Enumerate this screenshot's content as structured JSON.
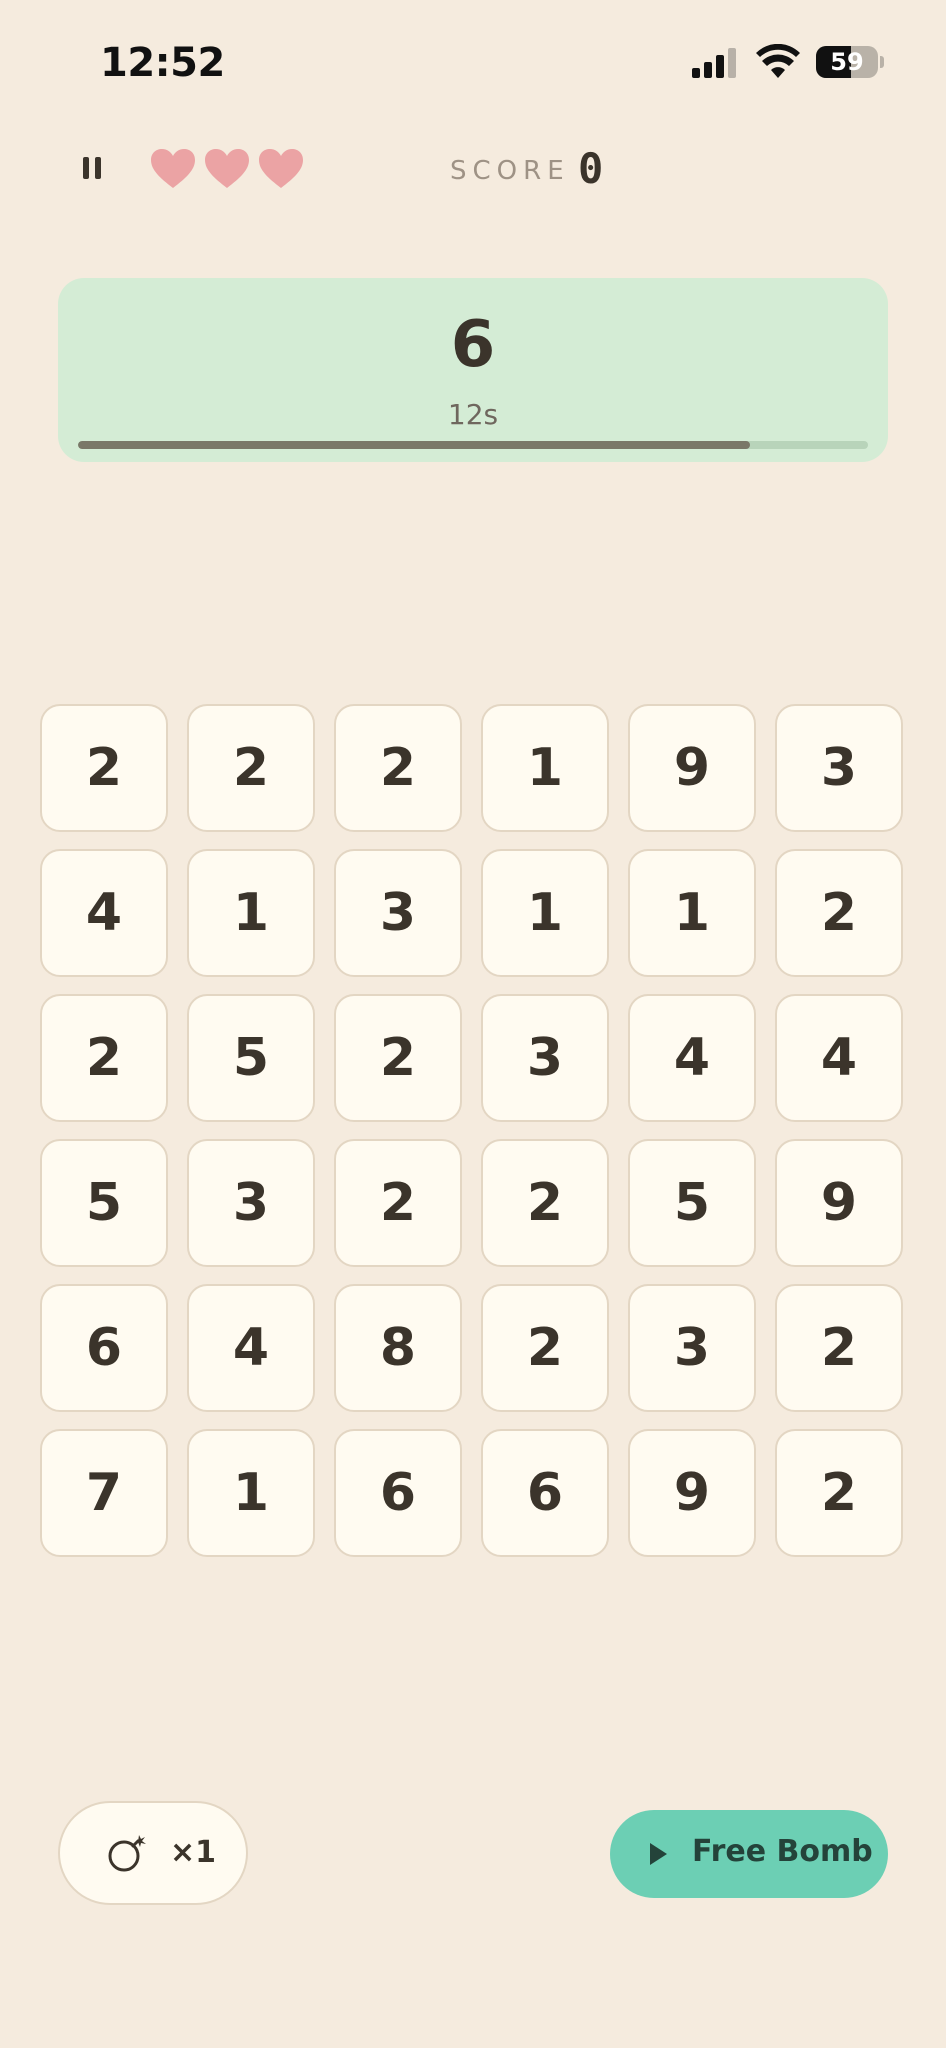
{
  "status_bar": {
    "time": "12:52",
    "battery_percent": "59",
    "battery_level": 0.59,
    "signal_bars": 3
  },
  "game_bar": {
    "pause_icon": "pause-icon",
    "lives": 3,
    "heart_color": "#eba3a4",
    "score_label": "SCORE",
    "score_value": "0"
  },
  "target": {
    "number": "6",
    "timer_text": "12s",
    "timer_progress": 0.85,
    "panel_color": "#d4ecd5"
  },
  "grid": {
    "columns": 6,
    "rows": [
      [
        "2",
        "2",
        "2",
        "1",
        "9",
        "3"
      ],
      [
        "4",
        "1",
        "3",
        "1",
        "1",
        "2"
      ],
      [
        "2",
        "5",
        "2",
        "3",
        "4",
        "4"
      ],
      [
        "5",
        "3",
        "2",
        "2",
        "5",
        "9"
      ],
      [
        "6",
        "4",
        "8",
        "2",
        "3",
        "2"
      ],
      [
        "7",
        "1",
        "6",
        "6",
        "9",
        "2"
      ]
    ]
  },
  "bottom": {
    "bomb_icon": "bomb-icon",
    "bomb_count": "×1",
    "free_bomb_icon": "play-icon",
    "free_bomb_label": "Free Bomb",
    "free_bomb_color": "#6ccfb4"
  }
}
